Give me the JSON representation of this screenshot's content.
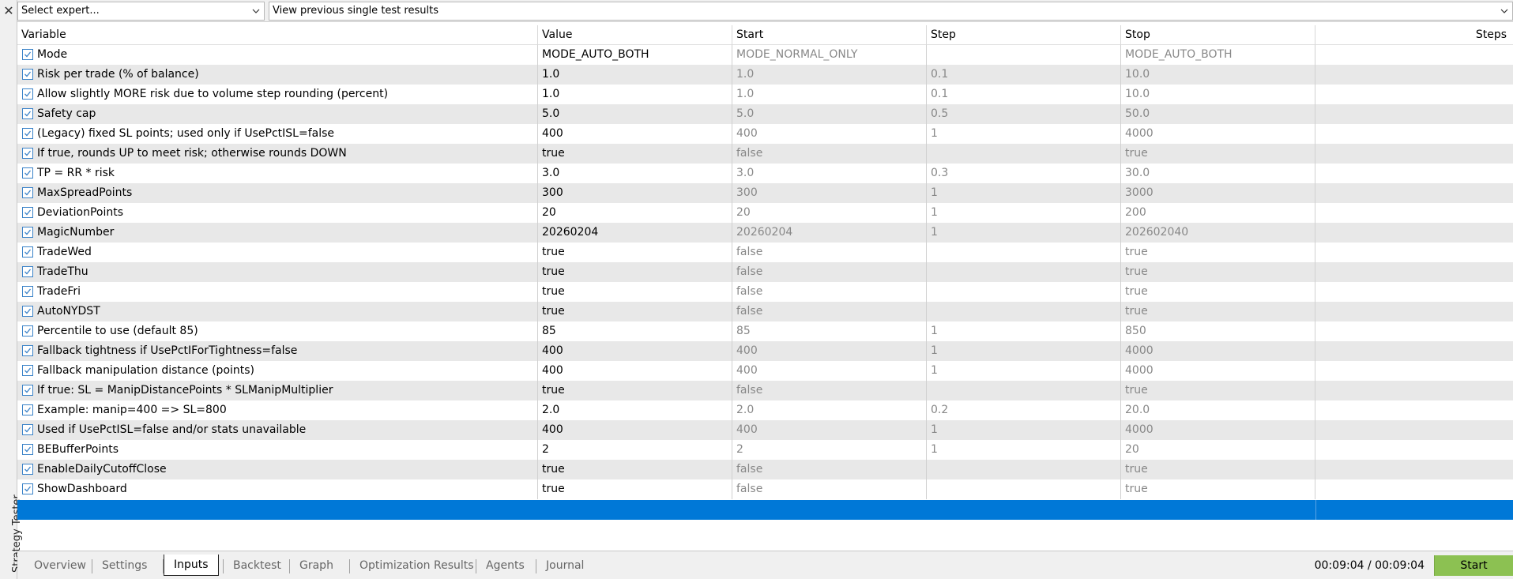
{
  "side": {
    "close_glyph": "✕",
    "panel_title": "Strategy Tester"
  },
  "top": {
    "expert_combo": "Select expert...",
    "results_combo": "View previous single test results"
  },
  "columns": {
    "variable": "Variable",
    "value": "Value",
    "start": "Start",
    "step": "Step",
    "stop": "Stop",
    "steps": "Steps"
  },
  "rows": [
    {
      "name": "Mode",
      "value": "MODE_AUTO_BOTH",
      "start": "MODE_NORMAL_ONLY",
      "step": "",
      "stop": "MODE_AUTO_BOTH",
      "steps": ""
    },
    {
      "name": "Risk per trade (% of balance)",
      "value": "1.0",
      "start": "1.0",
      "step": "0.1",
      "stop": "10.0",
      "steps": ""
    },
    {
      "name": "Allow slightly MORE risk due to volume step rounding (percent)",
      "value": "1.0",
      "start": "1.0",
      "step": "0.1",
      "stop": "10.0",
      "steps": ""
    },
    {
      "name": "Safety cap",
      "value": "5.0",
      "start": "5.0",
      "step": "0.5",
      "stop": "50.0",
      "steps": ""
    },
    {
      "name": "(Legacy) fixed SL points; used only if UsePctISL=false",
      "value": "400",
      "start": "400",
      "step": "1",
      "stop": "4000",
      "steps": ""
    },
    {
      "name": "If true, rounds UP to meet risk; otherwise rounds DOWN",
      "value": "true",
      "start": "false",
      "step": "",
      "stop": "true",
      "steps": ""
    },
    {
      "name": "TP = RR * risk",
      "value": "3.0",
      "start": "3.0",
      "step": "0.3",
      "stop": "30.0",
      "steps": ""
    },
    {
      "name": "MaxSpreadPoints",
      "value": "300",
      "start": "300",
      "step": "1",
      "stop": "3000",
      "steps": ""
    },
    {
      "name": "DeviationPoints",
      "value": "20",
      "start": "20",
      "step": "1",
      "stop": "200",
      "steps": ""
    },
    {
      "name": "MagicNumber",
      "value": "20260204",
      "start": "20260204",
      "step": "1",
      "stop": "202602040",
      "steps": ""
    },
    {
      "name": "TradeWed",
      "value": "true",
      "start": "false",
      "step": "",
      "stop": "true",
      "steps": ""
    },
    {
      "name": "TradeThu",
      "value": "true",
      "start": "false",
      "step": "",
      "stop": "true",
      "steps": ""
    },
    {
      "name": "TradeFri",
      "value": "true",
      "start": "false",
      "step": "",
      "stop": "true",
      "steps": ""
    },
    {
      "name": "AutoNYDST",
      "value": "true",
      "start": "false",
      "step": "",
      "stop": "true",
      "steps": ""
    },
    {
      "name": "Percentile to use (default 85)",
      "value": "85",
      "start": "85",
      "step": "1",
      "stop": "850",
      "steps": ""
    },
    {
      "name": "Fallback tightness if UsePctIForTightness=false",
      "value": "400",
      "start": "400",
      "step": "1",
      "stop": "4000",
      "steps": ""
    },
    {
      "name": "Fallback manipulation distance (points)",
      "value": "400",
      "start": "400",
      "step": "1",
      "stop": "4000",
      "steps": ""
    },
    {
      "name": "If true: SL = ManipDistancePoints * SLManipMultiplier",
      "value": "true",
      "start": "false",
      "step": "",
      "stop": "true",
      "steps": ""
    },
    {
      "name": "Example: manip=400 => SL=800",
      "value": "2.0",
      "start": "2.0",
      "step": "0.2",
      "stop": "20.0",
      "steps": ""
    },
    {
      "name": "Used if UsePctISL=false and/or stats unavailable",
      "value": "400",
      "start": "400",
      "step": "1",
      "stop": "4000",
      "steps": ""
    },
    {
      "name": "BEBufferPoints",
      "value": "2",
      "start": "2",
      "step": "1",
      "stop": "20",
      "steps": ""
    },
    {
      "name": "EnableDailyCutoffClose",
      "value": "true",
      "start": "false",
      "step": "",
      "stop": "true",
      "steps": ""
    },
    {
      "name": "ShowDashboard",
      "value": "true",
      "start": "false",
      "step": "",
      "stop": "true",
      "steps": ""
    }
  ],
  "tabs": [
    {
      "label": "Overview",
      "active": false
    },
    {
      "label": "Settings",
      "active": false
    },
    {
      "label": "Inputs",
      "active": true
    },
    {
      "label": "Backtest",
      "active": false
    },
    {
      "label": "Graph",
      "active": false
    },
    {
      "label": "Optimization Results",
      "active": false
    },
    {
      "label": "Agents",
      "active": false
    },
    {
      "label": "Journal",
      "active": false
    }
  ],
  "status": {
    "elapsed": "00:09:04 / 00:09:04",
    "start_label": "Start"
  },
  "colors": {
    "accent": "#0078d7",
    "start_button": "#8cc152",
    "checkbox": "#3a82c8"
  },
  "icons": {
    "close": "close-icon",
    "checkbox": "checkmark-icon",
    "combo": "chevron-down-icon"
  }
}
